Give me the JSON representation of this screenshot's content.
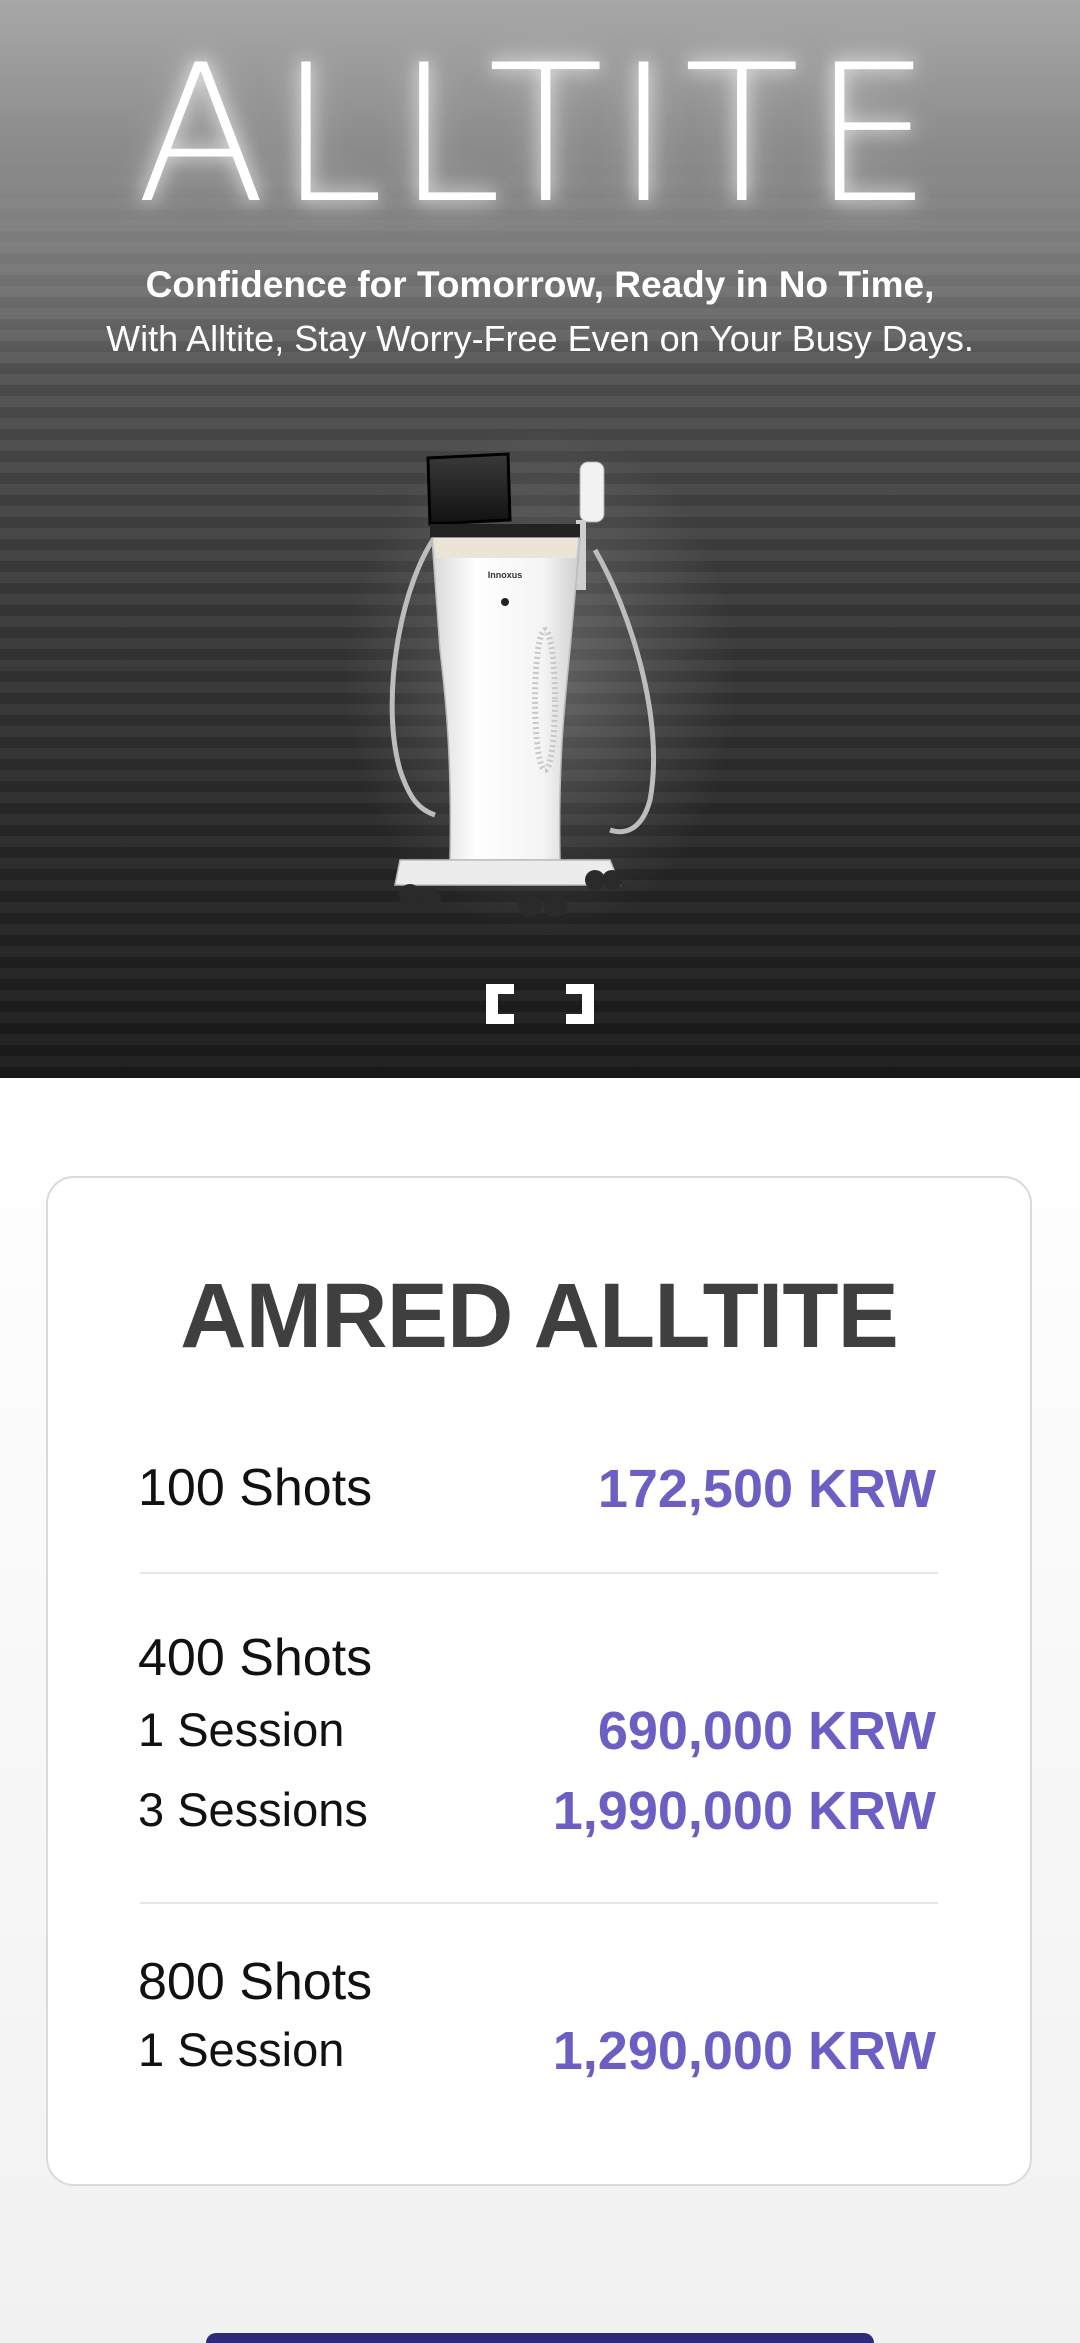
{
  "hero": {
    "title": "ALLTITE",
    "subtitle_bold": "Confidence for Tomorrow, Ready in No Time,",
    "subtitle": "With Alltite, Stay Worry-Free Even on Your Busy Days.",
    "device_brand": "Innoxus"
  },
  "pricing": {
    "title": "AMRED ALLTITE",
    "price_color": "#6b5fc3",
    "groups": [
      {
        "label": "100 Shots",
        "price": "172,500 KRW"
      },
      {
        "label": "400 Shots",
        "options": [
          {
            "label": "1 Session",
            "price": "690,000 KRW"
          },
          {
            "label": "3 Sessions",
            "price": "1,990,000 KRW"
          }
        ]
      },
      {
        "label": "800 Shots",
        "options": [
          {
            "label": "1 Session",
            "price": "1,290,000 KRW"
          }
        ]
      }
    ]
  }
}
